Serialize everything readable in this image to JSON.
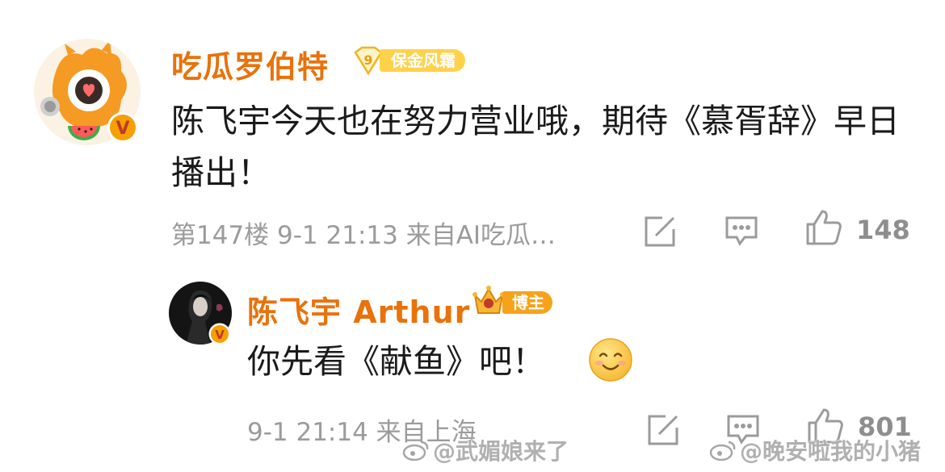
{
  "comment": {
    "username": "吃瓜罗伯特",
    "fan_badge": {
      "level": "9",
      "label": "保金风霜"
    },
    "text": "陈飞宇今天也在努力营业哦，期待《慕胥辞》早日播出！",
    "meta": "第147楼 9-1 21:13 来自AI吃瓜…",
    "likes": "148",
    "verified_mark": "V"
  },
  "reply": {
    "username": "陈飞宇 Arthur",
    "badge_label": "博主",
    "text": "你先看《献鱼》吧！",
    "meta": "9-1 21:14 来自上海",
    "likes": "801",
    "verified_mark": "V"
  },
  "watermarks": [
    "@武媚娘来了",
    "@晚安啦我的小猪"
  ],
  "colors": {
    "username": "#e8720c",
    "meta": "#9b9b9b",
    "fan_badge": "#ffd24a",
    "host_badge": "#f7a21b",
    "verified": "#f5a000"
  },
  "icons": [
    "repost-edit-icon",
    "comment-icon",
    "like-thumb-icon",
    "smile-emoji-icon",
    "weibo-logo-icon"
  ]
}
